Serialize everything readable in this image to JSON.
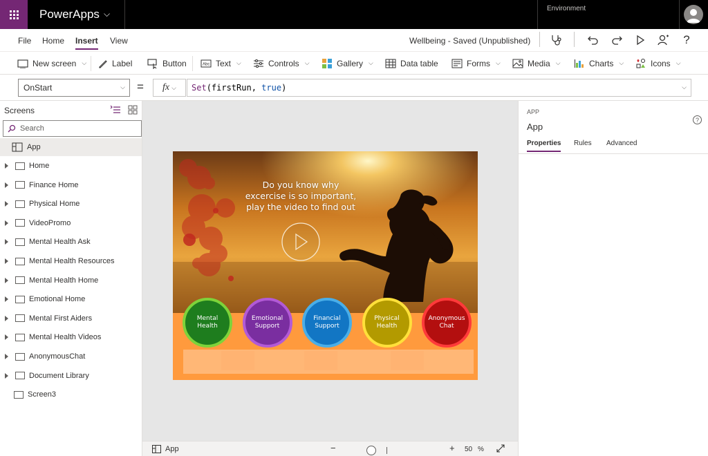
{
  "topbar": {
    "app_name": "PowerApps",
    "environment_label": "Environment"
  },
  "menu": {
    "tabs": [
      "File",
      "Home",
      "Insert",
      "View"
    ],
    "active_tab": "Insert",
    "doc_status": "Wellbeing - Saved (Unpublished)"
  },
  "ribbon": {
    "new_screen": "New screen",
    "label": "Label",
    "button": "Button",
    "text": "Text",
    "controls": "Controls",
    "gallery": "Gallery",
    "data_table": "Data table",
    "forms": "Forms",
    "media": "Media",
    "charts": "Charts",
    "icons": "Icons"
  },
  "formula": {
    "property": "OnStart",
    "equals": "=",
    "fx": "fx",
    "fn_name": "Set",
    "arg_open": "(firstRun, ",
    "arg_value": "true",
    "arg_close": ")"
  },
  "left_panel": {
    "title": "Screens",
    "search_placeholder": "Search",
    "app_item": "App",
    "screens": [
      "Home",
      "Finance Home",
      "Physical Home",
      "VideoPromo",
      "Mental Health Ask",
      "Mental Health Resources",
      "Mental Health Home",
      "Emotional Home",
      "Mental First Aiders",
      "Mental Health Videos",
      "AnonymousChat",
      "Document Library"
    ],
    "leaf_screen": "Screen3"
  },
  "canvas": {
    "headline_line1": "Do you know why",
    "headline_line2": "excercise is so important,",
    "headline_line3": "play the video to find out",
    "circles": [
      {
        "line1": "Mental",
        "line2": "Health",
        "fill": "#1e7d1e",
        "ring": "#7dd33a"
      },
      {
        "line1": "Emotional",
        "line2": "Support",
        "fill": "#7a2ea0",
        "ring": "#b25ad6"
      },
      {
        "line1": "Financial",
        "line2": "Support",
        "fill": "#1276c4",
        "ring": "#49aee8"
      },
      {
        "line1": "Physical",
        "line2": "Health",
        "fill": "#b39a00",
        "ring": "#ffe03a"
      },
      {
        "line1": "Anonymous",
        "line2": "Chat",
        "fill": "#b30f0f",
        "ring": "#ff3a3a"
      }
    ]
  },
  "bottom_bar": {
    "selected": "App",
    "zoom_minus": "−",
    "zoom_plus": "+",
    "zoom_value": "50",
    "zoom_unit": "%"
  },
  "right_panel": {
    "kind": "APP",
    "name": "App",
    "tabs": [
      "Properties",
      "Rules",
      "Advanced"
    ],
    "active_tab": "Properties"
  },
  "colors": {
    "accent": "#742774",
    "canvas_bg": "#e6e6e6"
  }
}
